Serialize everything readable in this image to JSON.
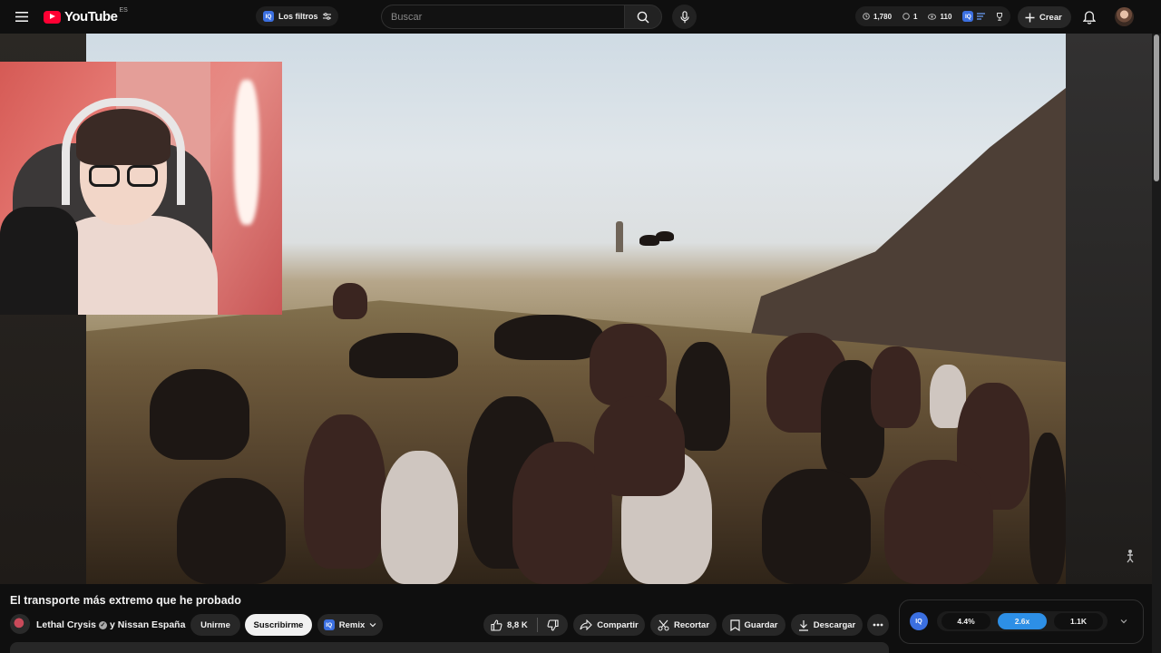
{
  "header": {
    "logo_text": "YouTube",
    "country_code": "ES",
    "filters_label": "Los filtros",
    "search_placeholder": "Buscar",
    "stats": {
      "a": "1,780",
      "b": "1",
      "c": "110"
    },
    "create_label": "Crear"
  },
  "video": {
    "title": "El transporte más extremo que he probado",
    "channel_name": "Lethal Crysis",
    "collab_text": "y Nissan España"
  },
  "actions": {
    "join_label": "Unirme",
    "subscribe_label": "Suscribirme",
    "remix_label": "Remix",
    "like_count": "8,8 K",
    "share_label": "Compartir",
    "clip_label": "Recortar",
    "save_label": "Guardar",
    "download_label": "Descargar"
  },
  "speed_panel": {
    "values": [
      "4.4%",
      "2.6x",
      "1.1K"
    ],
    "active_index": 1,
    "accent": "#2d8fe6"
  },
  "colors": {
    "accent": "#3b6fe0",
    "brand": "#ff0033"
  },
  "icons": [
    "menu-icon",
    "youtube-logo-icon",
    "iq-icon",
    "filter-icon",
    "search-icon",
    "mic-icon",
    "clock-icon",
    "eye-icon",
    "create-plus-icon",
    "bell-icon",
    "like-icon",
    "dislike-icon",
    "share-icon",
    "scissors-icon",
    "bookmark-icon",
    "download-icon",
    "more-icon",
    "chevron-down-icon"
  ]
}
